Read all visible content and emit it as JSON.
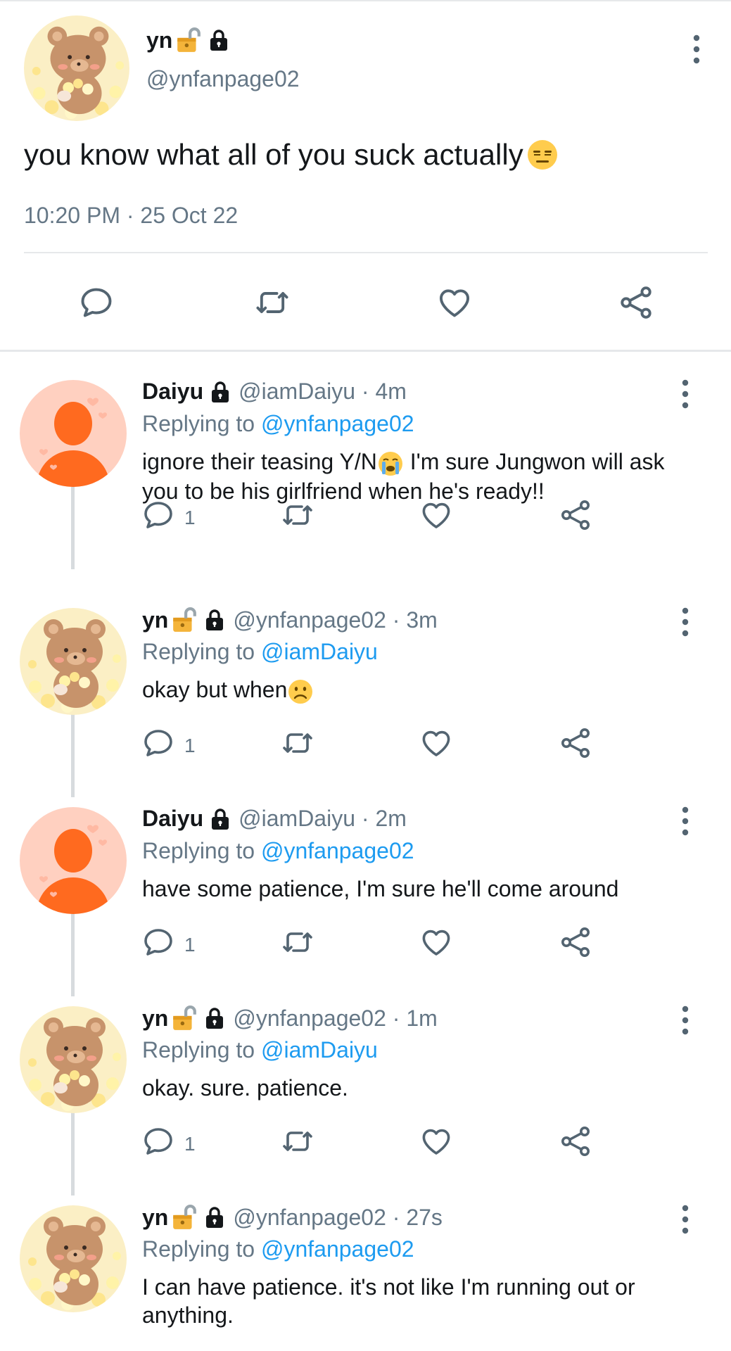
{
  "main_tweet": {
    "display_name": "yn",
    "handle": "@ynfanpage02",
    "text": "you know what all of you suck actually",
    "timestamp": "10:20 PM · 25 Oct 22"
  },
  "replies": [
    {
      "display_name": "Daiyu",
      "meta": "@iamDaiyu · 4m",
      "replying_label": "Replying to",
      "replying_to": "@ynfanpage02",
      "text_a": "ignore their teasing Y/N",
      "text_b": " I'm sure Jungwon will ask you to be his girlfriend when he's ready!!",
      "reply_count": "1",
      "avatar": "default"
    },
    {
      "display_name": "yn",
      "meta": "@ynfanpage02 · 3m",
      "replying_label": "Replying to",
      "replying_to": "@iamDaiyu",
      "text_a": "okay but when",
      "reply_count": "1",
      "avatar": "bear"
    },
    {
      "display_name": "Daiyu",
      "meta": "@iamDaiyu · 2m",
      "replying_label": "Replying to",
      "replying_to": "@ynfanpage02",
      "text_a": "have some patience, I'm sure he'll come around",
      "reply_count": "1",
      "avatar": "default"
    },
    {
      "display_name": "yn",
      "meta": "@ynfanpage02 · 1m",
      "replying_label": "Replying to",
      "replying_to": "@iamDaiyu",
      "text_a": "okay. sure. patience.",
      "reply_count": "1",
      "avatar": "bear"
    },
    {
      "display_name": "yn",
      "meta": "@ynfanpage02 · 27s",
      "replying_label": "Replying to",
      "replying_to": "@ynfanpage02",
      "text_a": "I can have patience. it's not like I'm running out or anything.",
      "avatar": "bear"
    }
  ],
  "colors": {
    "accent": "#1d9bf0",
    "secondary_text": "#657786",
    "icon": "#536471",
    "divider": "#e6e8ea",
    "default_avatar_bg": "#ffd0c0",
    "default_avatar_fg": "#ff6a1f"
  },
  "icons": [
    "lock-emoji-icon",
    "padlock-icon",
    "more-vert-icon",
    "reply-icon",
    "retweet-icon",
    "like-icon",
    "share-icon",
    "expressionless-emoji",
    "crying-emoji",
    "frowning-emoji"
  ]
}
